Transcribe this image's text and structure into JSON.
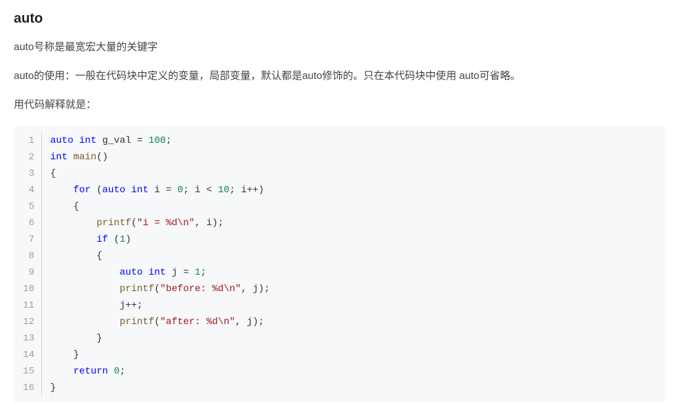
{
  "heading": "auto",
  "paragraphs": [
    "auto号称是最宽宏大量的关键字",
    "auto的使用：一般在代码块中定义的变量，局部变量，默认都是auto修饰的。只在本代码块中使用 auto可省略。",
    "用代码解释就是："
  ],
  "code": {
    "lines": [
      {
        "n": 1,
        "tokens": [
          [
            "kw",
            "auto"
          ],
          [
            "pl",
            " "
          ],
          [
            "kw",
            "int"
          ],
          [
            "pl",
            " g_val = "
          ],
          [
            "num",
            "100"
          ],
          [
            "pl",
            ";"
          ]
        ]
      },
      {
        "n": 2,
        "tokens": [
          [
            "kw",
            "int"
          ],
          [
            "pl",
            " "
          ],
          [
            "fn",
            "main"
          ],
          [
            "pl",
            "()"
          ]
        ]
      },
      {
        "n": 3,
        "tokens": [
          [
            "pl",
            "{"
          ]
        ]
      },
      {
        "n": 4,
        "tokens": [
          [
            "pl",
            "    "
          ],
          [
            "kw",
            "for"
          ],
          [
            "pl",
            " ("
          ],
          [
            "kw",
            "auto"
          ],
          [
            "pl",
            " "
          ],
          [
            "kw",
            "int"
          ],
          [
            "pl",
            " i = "
          ],
          [
            "num",
            "0"
          ],
          [
            "pl",
            "; i < "
          ],
          [
            "num",
            "10"
          ],
          [
            "pl",
            "; i++)"
          ]
        ]
      },
      {
        "n": 5,
        "tokens": [
          [
            "pl",
            "    {"
          ]
        ]
      },
      {
        "n": 6,
        "tokens": [
          [
            "pl",
            "        "
          ],
          [
            "fn",
            "printf"
          ],
          [
            "pl",
            "("
          ],
          [
            "str",
            "\"i = %d\\n\""
          ],
          [
            "pl",
            ", i);"
          ]
        ]
      },
      {
        "n": 7,
        "tokens": [
          [
            "pl",
            "        "
          ],
          [
            "kw",
            "if"
          ],
          [
            "pl",
            " ("
          ],
          [
            "num",
            "1"
          ],
          [
            "pl",
            ")"
          ]
        ]
      },
      {
        "n": 8,
        "tokens": [
          [
            "pl",
            "        {"
          ]
        ]
      },
      {
        "n": 9,
        "tokens": [
          [
            "pl",
            "            "
          ],
          [
            "kw",
            "auto"
          ],
          [
            "pl",
            " "
          ],
          [
            "kw",
            "int"
          ],
          [
            "pl",
            " j = "
          ],
          [
            "num",
            "1"
          ],
          [
            "pl",
            ";"
          ]
        ]
      },
      {
        "n": 10,
        "tokens": [
          [
            "pl",
            "            "
          ],
          [
            "fn",
            "printf"
          ],
          [
            "pl",
            "("
          ],
          [
            "str",
            "\"before: %d\\n\""
          ],
          [
            "pl",
            ", j);"
          ]
        ]
      },
      {
        "n": 11,
        "tokens": [
          [
            "pl",
            "            j++;"
          ]
        ]
      },
      {
        "n": 12,
        "tokens": [
          [
            "pl",
            "            "
          ],
          [
            "fn",
            "printf"
          ],
          [
            "pl",
            "("
          ],
          [
            "str",
            "\"after: %d\\n\""
          ],
          [
            "pl",
            ", j);"
          ]
        ]
      },
      {
        "n": 13,
        "tokens": [
          [
            "pl",
            "        }"
          ]
        ]
      },
      {
        "n": 14,
        "tokens": [
          [
            "pl",
            "    }"
          ]
        ]
      },
      {
        "n": 15,
        "tokens": [
          [
            "pl",
            "    "
          ],
          [
            "kw",
            "return"
          ],
          [
            "pl",
            " "
          ],
          [
            "num",
            "0"
          ],
          [
            "pl",
            ";"
          ]
        ]
      },
      {
        "n": 16,
        "tokens": [
          [
            "pl",
            "}"
          ]
        ]
      }
    ]
  }
}
